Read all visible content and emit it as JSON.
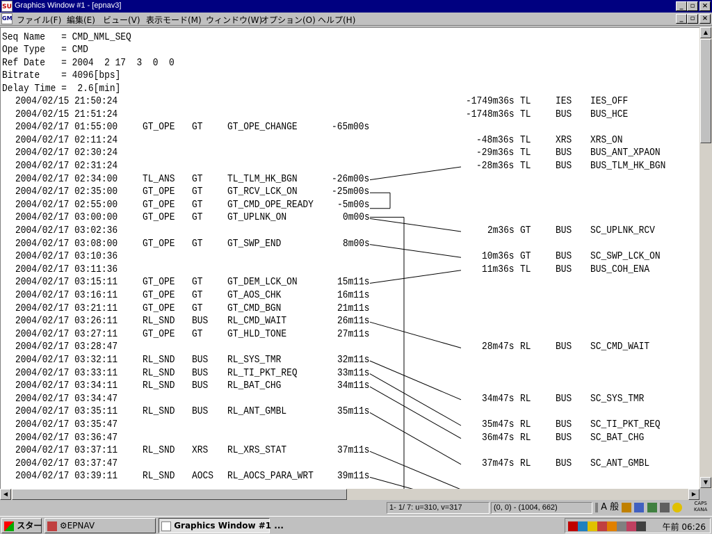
{
  "window": {
    "title": "Graphics Window #1 - [epnav3]",
    "app_icon_text": "SU",
    "menu": [
      "ファイル(F)",
      "編集(E)",
      "ビュー(V)",
      "表示モード(M)",
      "ウィンドウ(W)",
      "オプション(O)",
      "ヘルプ(H)"
    ]
  },
  "header": [
    "Seq Name   = CMD_NML_SEQ",
    "Ope Type   = CMD",
    "Ref Date   = 2004  2 17  3  0  0",
    "Bitrate    = 4096[bps]",
    "Delay Time =  2.6[min]"
  ],
  "ground_rows": [
    {
      "time": "2004/02/15 21:50:24",
      "kind": "",
      "sub": "",
      "name": "",
      "offset": ""
    },
    {
      "time": "2004/02/15 21:51:24",
      "kind": "",
      "sub": "",
      "name": "",
      "offset": ""
    },
    {
      "time": "2004/02/17 01:55:00",
      "kind": "GT_OPE",
      "sub": "GT",
      "name": "GT_OPE_CHANGE",
      "offset": "-65m00s"
    },
    {
      "time": "2004/02/17 02:11:24",
      "kind": "",
      "sub": "",
      "name": "",
      "offset": ""
    },
    {
      "time": "2004/02/17 02:30:24",
      "kind": "",
      "sub": "",
      "name": "",
      "offset": ""
    },
    {
      "time": "2004/02/17 02:31:24",
      "kind": "",
      "sub": "",
      "name": "",
      "offset": ""
    },
    {
      "time": "2004/02/17 02:34:00",
      "kind": "TL_ANS",
      "sub": "GT",
      "name": "TL_TLM_HK_BGN",
      "offset": "-26m00s"
    },
    {
      "time": "2004/02/17 02:35:00",
      "kind": "GT_OPE",
      "sub": "GT",
      "name": "GT_RCV_LCK_ON",
      "offset": "-25m00s"
    },
    {
      "time": "2004/02/17 02:55:00",
      "kind": "GT_OPE",
      "sub": "GT",
      "name": "GT_CMD_OPE_READY",
      "offset": "-5m00s"
    },
    {
      "time": "2004/02/17 03:00:00",
      "kind": "GT_OPE",
      "sub": "GT",
      "name": "GT_UPLNK_ON",
      "offset": "0m00s"
    },
    {
      "time": "2004/02/17 03:02:36",
      "kind": "",
      "sub": "",
      "name": "",
      "offset": ""
    },
    {
      "time": "2004/02/17 03:08:00",
      "kind": "GT_OPE",
      "sub": "GT",
      "name": "GT_SWP_END",
      "offset": "8m00s"
    },
    {
      "time": "2004/02/17 03:10:36",
      "kind": "",
      "sub": "",
      "name": "",
      "offset": ""
    },
    {
      "time": "2004/02/17 03:11:36",
      "kind": "",
      "sub": "",
      "name": "",
      "offset": ""
    },
    {
      "time": "2004/02/17 03:15:11",
      "kind": "GT_OPE",
      "sub": "GT",
      "name": "GT_DEM_LCK_ON",
      "offset": "15m11s"
    },
    {
      "time": "2004/02/17 03:16:11",
      "kind": "GT_OPE",
      "sub": "GT",
      "name": "GT_AOS_CHK",
      "offset": "16m11s"
    },
    {
      "time": "2004/02/17 03:21:11",
      "kind": "GT_OPE",
      "sub": "GT",
      "name": "GT_CMD_BGN",
      "offset": "21m11s"
    },
    {
      "time": "2004/02/17 03:26:11",
      "kind": "RL_SND",
      "sub": "BUS",
      "name": "RL_CMD_WAIT",
      "offset": "26m11s"
    },
    {
      "time": "2004/02/17 03:27:11",
      "kind": "GT_OPE",
      "sub": "GT",
      "name": "GT_HLD_TONE",
      "offset": "27m11s"
    },
    {
      "time": "2004/02/17 03:28:47",
      "kind": "",
      "sub": "",
      "name": "",
      "offset": ""
    },
    {
      "time": "2004/02/17 03:32:11",
      "kind": "RL_SND",
      "sub": "BUS",
      "name": "RL_SYS_TMR",
      "offset": "32m11s"
    },
    {
      "time": "2004/02/17 03:33:11",
      "kind": "RL_SND",
      "sub": "BUS",
      "name": "RL_TI_PKT_REQ",
      "offset": "33m11s"
    },
    {
      "time": "2004/02/17 03:34:11",
      "kind": "RL_SND",
      "sub": "BUS",
      "name": "RL_BAT_CHG",
      "offset": "34m11s"
    },
    {
      "time": "2004/02/17 03:34:47",
      "kind": "",
      "sub": "",
      "name": "",
      "offset": ""
    },
    {
      "time": "2004/02/17 03:35:11",
      "kind": "RL_SND",
      "sub": "BUS",
      "name": "RL_ANT_GMBL",
      "offset": "35m11s"
    },
    {
      "time": "2004/02/17 03:35:47",
      "kind": "",
      "sub": "",
      "name": "",
      "offset": ""
    },
    {
      "time": "2004/02/17 03:36:47",
      "kind": "",
      "sub": "",
      "name": "",
      "offset": ""
    },
    {
      "time": "2004/02/17 03:37:11",
      "kind": "RL_SND",
      "sub": "XRS",
      "name": "RL_XRS_STAT",
      "offset": "37m11s"
    },
    {
      "time": "2004/02/17 03:37:47",
      "kind": "",
      "sub": "",
      "name": "",
      "offset": ""
    },
    {
      "time": "2004/02/17 03:39:11",
      "kind": "RL_SND",
      "sub": "AOCS",
      "name": "RL_AOCS_PARA_WRT",
      "offset": "39m11s"
    }
  ],
  "sc_rows": [
    {
      "row": 0,
      "offset": "-1749m36s",
      "kind": "TL",
      "sub": "IES",
      "name": "IES_OFF"
    },
    {
      "row": 1,
      "offset": "-1748m36s",
      "kind": "TL",
      "sub": "BUS",
      "name": "BUS_HCE"
    },
    {
      "row": 3,
      "offset": "-48m36s",
      "kind": "TL",
      "sub": "XRS",
      "name": "XRS_ON"
    },
    {
      "row": 4,
      "offset": "-29m36s",
      "kind": "TL",
      "sub": "BUS",
      "name": "BUS_ANT_XPAON"
    },
    {
      "row": 5,
      "offset": "-28m36s",
      "kind": "TL",
      "sub": "BUS",
      "name": "BUS_TLM_HK_BGN"
    },
    {
      "row": 10,
      "offset": "2m36s",
      "kind": "GT",
      "sub": "BUS",
      "name": "SC_UPLNK_RCV"
    },
    {
      "row": 12,
      "offset": "10m36s",
      "kind": "GT",
      "sub": "BUS",
      "name": "SC_SWP_LCK_ON"
    },
    {
      "row": 13,
      "offset": "11m36s",
      "kind": "TL",
      "sub": "BUS",
      "name": "BUS_COH_ENA"
    },
    {
      "row": 19,
      "offset": "28m47s",
      "kind": "RL",
      "sub": "BUS",
      "name": "SC_CMD_WAIT"
    },
    {
      "row": 23,
      "offset": "34m47s",
      "kind": "RL",
      "sub": "BUS",
      "name": "SC_SYS_TMR"
    },
    {
      "row": 25,
      "offset": "35m47s",
      "kind": "RL",
      "sub": "BUS",
      "name": "SC_TI_PKT_REQ"
    },
    {
      "row": 26,
      "offset": "36m47s",
      "kind": "RL",
      "sub": "BUS",
      "name": "SC_BAT_CHG"
    },
    {
      "row": 28,
      "offset": "37m47s",
      "kind": "RL",
      "sub": "BUS",
      "name": "SC_ANT_GMBL"
    }
  ],
  "links": [
    [
      6,
      5
    ],
    [
      9,
      10
    ],
    [
      11,
      12
    ],
    [
      14,
      13
    ],
    [
      17,
      19
    ],
    [
      20,
      23
    ],
    [
      21,
      25
    ],
    [
      22,
      26
    ],
    [
      24,
      28
    ]
  ],
  "status": {
    "position": "1- 1/ 7: u=310, v=317",
    "range": "(0, 0) - (1004, 662)",
    "ime_mode": "A 般",
    "caps": "CAPS",
    "kana": "KANA"
  },
  "taskbar": {
    "start": "スタート",
    "items": [
      "EPNAV",
      "Graphics Window #1 ..."
    ],
    "clock": "午前 06:26"
  }
}
